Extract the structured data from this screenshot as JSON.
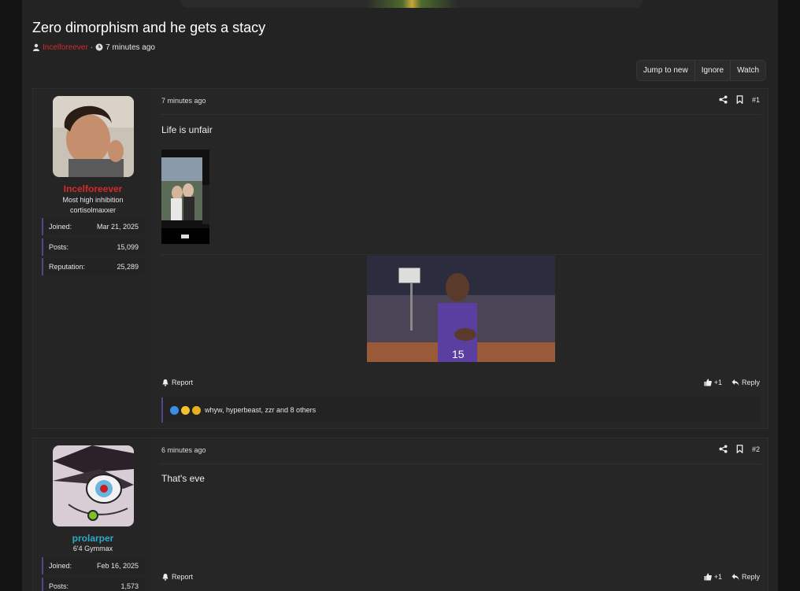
{
  "thread": {
    "title": "Zero dimorphism and he gets a stacy",
    "author": "Incelforeever",
    "separator": "·",
    "time": "7 minutes ago",
    "actions": {
      "jump": "Jump to new",
      "ignore": "Ignore",
      "watch": "Watch"
    }
  },
  "posts": [
    {
      "username": "Incelforeever",
      "usertitle_line1": "Most high inhibition",
      "usertitle_line2": "cortisolmaxxer",
      "stats": [
        {
          "label": "Joined:",
          "value": "Mar 21, 2025"
        },
        {
          "label": "Posts:",
          "value": "15,099"
        },
        {
          "label": "Reputation:",
          "value": "25,289"
        }
      ],
      "date": "7 minutes ago",
      "number": "#1",
      "text": "Life is unfair",
      "report": "Report",
      "plus": "+1",
      "reply": "Reply",
      "reactions_text": "whyw, hyperbeast, zzr and 8 others"
    },
    {
      "username": "prolarper",
      "usertitle_line1": "6'4 Gymmax",
      "stats": [
        {
          "label": "Joined:",
          "value": "Feb 16, 2025"
        },
        {
          "label": "Posts:",
          "value": "1,573"
        }
      ],
      "date": "6 minutes ago",
      "number": "#2",
      "text": "That's eve",
      "report": "Report",
      "plus": "+1",
      "reply": "Reply"
    }
  ],
  "colors": {
    "username_red": "#d42a2a",
    "username_teal": "#2fa8c9",
    "online": "#7cc127"
  }
}
